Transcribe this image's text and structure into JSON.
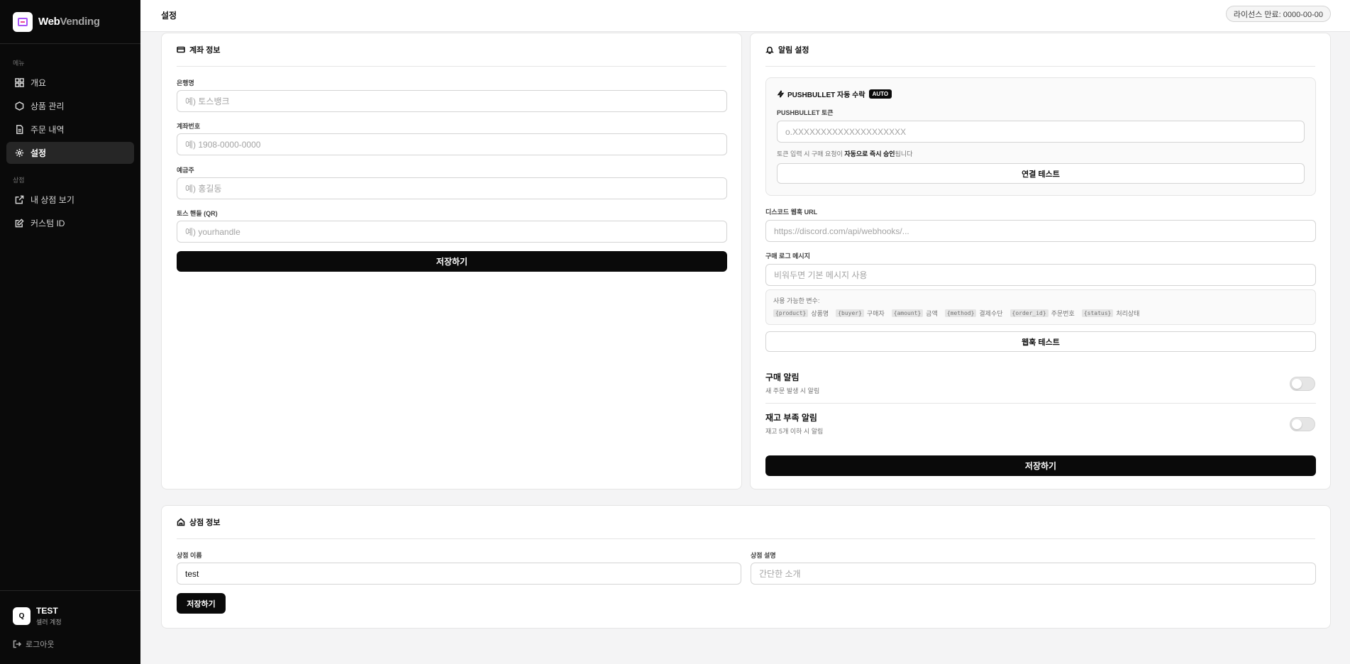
{
  "brand": {
    "name_bold": "Web",
    "name_light": "Vending"
  },
  "sidebar": {
    "menu_label": "메뉴",
    "menu_items": [
      {
        "label": "개요",
        "icon": "grid-icon"
      },
      {
        "label": "상품 관리",
        "icon": "box-icon"
      },
      {
        "label": "주문 내역",
        "icon": "document-icon"
      },
      {
        "label": "설정",
        "icon": "gear-icon"
      }
    ],
    "shop_label": "상점",
    "shop_items": [
      {
        "label": "내 상점 보기",
        "icon": "external-link-icon"
      },
      {
        "label": "커스텀 ID",
        "icon": "edit-icon"
      }
    ],
    "user": {
      "initial": "Q",
      "name": "TEST",
      "role": "셀러 계정"
    },
    "logout": "로그아웃"
  },
  "header": {
    "title": "설정",
    "license": "라이선스 만료: 0000-00-00"
  },
  "account": {
    "title": "계좌 정보",
    "bank_label": "은행명",
    "bank_placeholder": "예) 토스뱅크",
    "number_label": "계좌번호",
    "number_placeholder": "예) 1908-0000-0000",
    "holder_label": "예금주",
    "holder_placeholder": "예) 홍길동",
    "toss_label": "토스 핸들 (QR)",
    "toss_placeholder": "예) yourhandle",
    "save": "저장하기"
  },
  "alerts": {
    "title": "알림 설정",
    "pushbullet": {
      "title": "PUSHBULLET 자동 수락",
      "badge": "AUTO",
      "token_label": "PUSHBULLET 토큰",
      "token_placeholder": "o.XXXXXXXXXXXXXXXXXXXX",
      "hint_prefix": "토큰 입력 시 구매 요청이 ",
      "hint_bold": "자동으로 즉시 승인",
      "hint_suffix": "됩니다",
      "test": "연결 테스트"
    },
    "discord_label": "디스코드 웹훅 URL",
    "discord_placeholder": "https://discord.com/api/webhooks/...",
    "log_label": "구매 로그 메시지",
    "log_placeholder": "비워두면 기본 메시지 사용",
    "vars_title": "사용 가능한 변수:",
    "vars": [
      {
        "key": "{product}",
        "desc": "상품명"
      },
      {
        "key": "{buyer}",
        "desc": "구매자"
      },
      {
        "key": "{amount}",
        "desc": "금액"
      },
      {
        "key": "{method}",
        "desc": "결제수단"
      },
      {
        "key": "{order_id}",
        "desc": "주문번호"
      },
      {
        "key": "{status}",
        "desc": "처리상태"
      }
    ],
    "webhook_test": "웹훅 테스트",
    "purchase_title": "구매 알림",
    "purchase_sub": "새 주문 발생 시 알림",
    "stock_title": "재고 부족 알림",
    "stock_sub": "재고 5개 이하 시 알림",
    "save": "저장하기"
  },
  "shop": {
    "title": "상점 정보",
    "name_label": "상점 이름",
    "name_value": "test",
    "desc_label": "상점 설명",
    "desc_placeholder": "간단한 소개",
    "save": "저장하기"
  }
}
